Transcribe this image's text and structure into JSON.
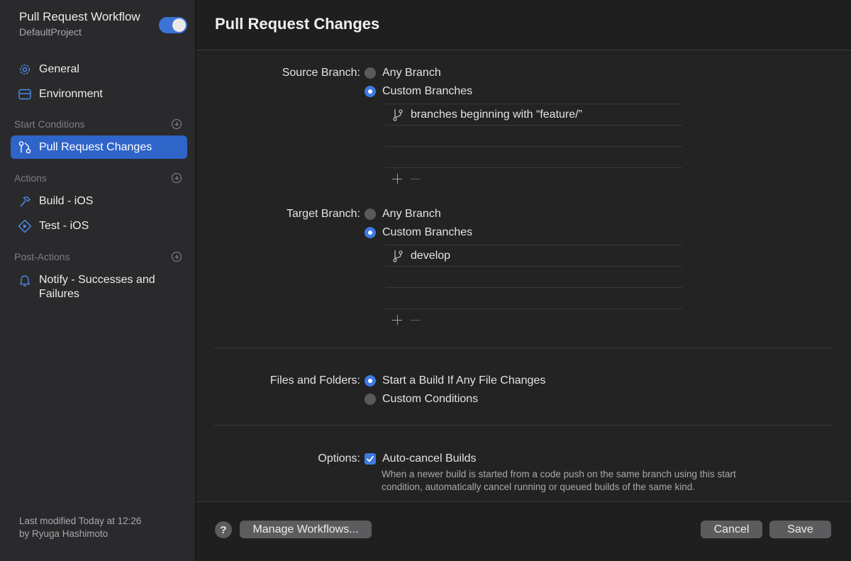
{
  "sidebar": {
    "title": "Pull Request Workflow",
    "subtitle": "DefaultProject",
    "enabled": true,
    "items": {
      "general": "General",
      "environment": "Environment",
      "pull_request_changes": "Pull Request Changes",
      "build_ios": "Build - iOS",
      "test_ios": "Test - iOS",
      "notify": "Notify - Successes and Failures"
    },
    "sections": {
      "start_conditions": "Start Conditions",
      "actions": "Actions",
      "post_actions": "Post-Actions"
    },
    "footer_line1": "Last modified Today at 12:26",
    "footer_line2": "by Ryuga Hashimoto"
  },
  "main": {
    "title": "Pull Request Changes",
    "source_branch": {
      "label": "Source Branch:",
      "any_branch": "Any Branch",
      "custom_branches": "Custom Branches",
      "selected": "Custom Branches",
      "rows": [
        "branches beginning with “feature/”"
      ]
    },
    "target_branch": {
      "label": "Target Branch:",
      "any_branch": "Any Branch",
      "custom_branches": "Custom Branches",
      "selected": "Custom Branches",
      "rows": [
        "develop"
      ]
    },
    "files_and_folders": {
      "label": "Files and Folders:",
      "option_any": "Start a Build If Any File Changes",
      "option_custom": "Custom Conditions",
      "selected": "Start a Build If Any File Changes"
    },
    "options": {
      "label": "Options:",
      "auto_cancel": "Auto-cancel Builds",
      "auto_cancel_checked": true,
      "description_line1": "When a newer build is started from a code push on the same branch using this start",
      "description_line2": "condition, automatically cancel running or queued builds of the same kind."
    }
  },
  "footer": {
    "help": "?",
    "manage_workflows": "Manage Workflows...",
    "cancel": "Cancel",
    "save": "Save"
  },
  "colors": {
    "accent": "#3d7ae0",
    "selection": "#2f64c9",
    "sidebar_bg": "#2a2a2c",
    "content_bg": "#232323"
  }
}
